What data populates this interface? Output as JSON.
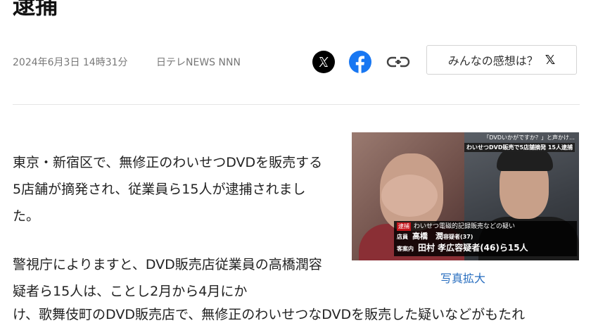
{
  "article": {
    "title": "逮捕",
    "date": "2024年6月3日 14時31分",
    "source": "日テレNEWS NNN",
    "paragraphs": [
      "東京・新宿区で、無修正のわいせつDVDを販売する5店舗が摘発され、従業員ら15人が逮捕されました。",
      "警視庁によりますと、DVD販売店従業員の高橋潤容疑者ら15人は、ことし2月から4月にか",
      "け、歌舞伎町のDVD販売店で、無修正のわいせつなDVDを販売した疑いなどがもたれ"
    ]
  },
  "share": {
    "x_icon": "x-logo-icon",
    "facebook_icon": "facebook-logo-icon",
    "link_icon": "link-icon",
    "feedback_label": "みんなの感想は？",
    "feedback_x": "𝕏"
  },
  "photo": {
    "caption_top_1": "「DVDいかがですか？」と声かけ…",
    "caption_top_2": "わいせつDVD販売で5店舗摘発 15人逮捕",
    "tag": "逮捕",
    "charge": "わいせつ電磁的記録販売などの疑い",
    "person1_role": "店員",
    "person1_name": "高橋　潤",
    "person1_suffix": "容疑者(37)",
    "person2_role": "客案内",
    "person2_name": "田村 孝広",
    "person2_suffix": "容疑者(46)ら15人",
    "expand_label": "写真拡大"
  },
  "colors": {
    "link": "#2a6fc0",
    "facebook": "#1877f2",
    "x_bg": "#000000"
  }
}
